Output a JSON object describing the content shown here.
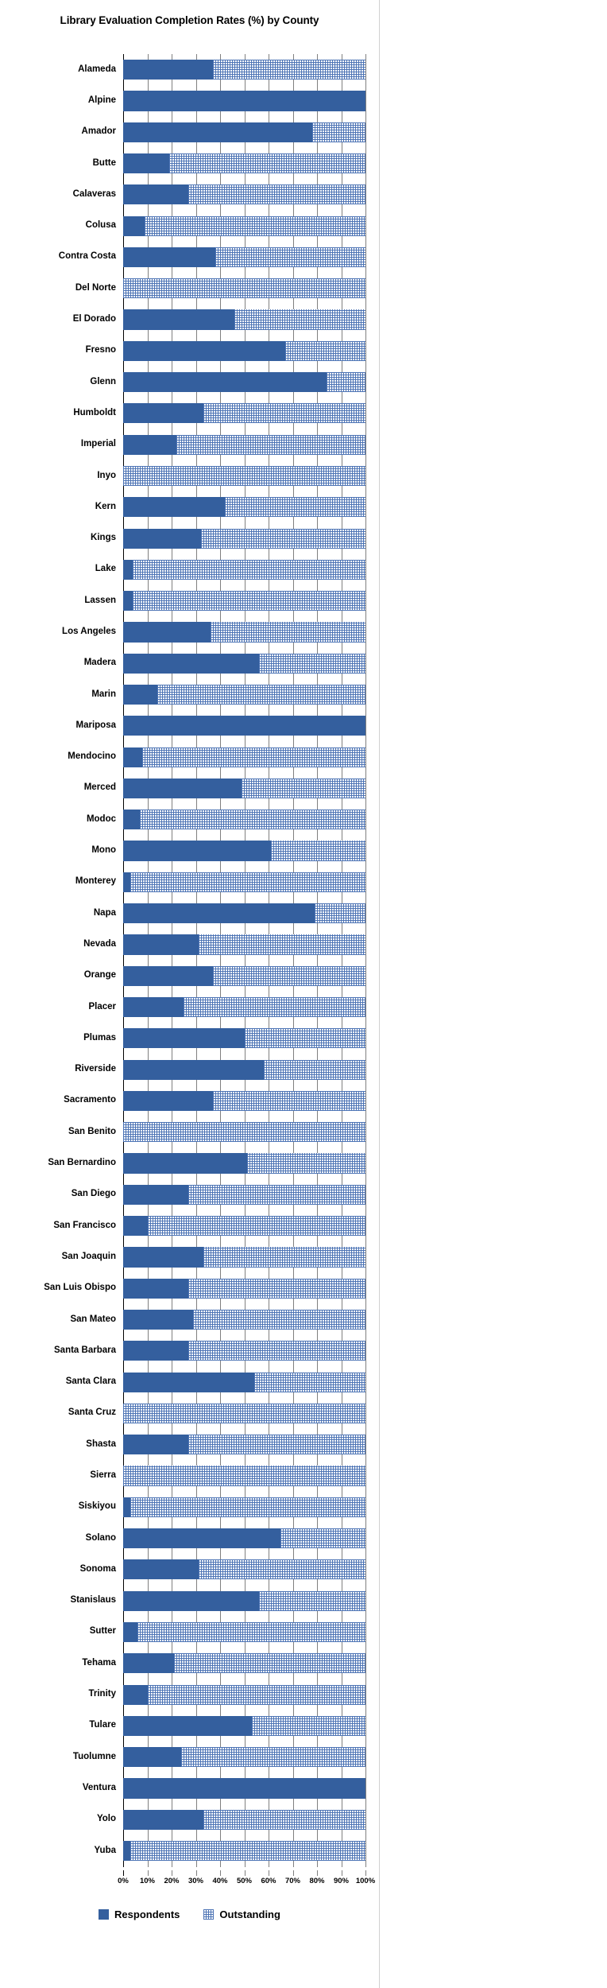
{
  "chart_data": {
    "type": "bar",
    "title": "Library Evaluation Completion Rates (%) by County",
    "xlabel": "",
    "ylabel": "",
    "orientation": "horizontal",
    "stacked": true,
    "xlim": [
      0,
      100
    ],
    "grid": true,
    "legend_position": "bottom",
    "colors": {
      "respondents": "#345F9E",
      "outstanding": "#4d74b5",
      "background": "#ffffff",
      "gridline": "#808080",
      "axis": "#000000"
    },
    "tick_labels": [
      "0%",
      "10%",
      "20%",
      "30%",
      "40%",
      "50%",
      "60%",
      "70%",
      "80%",
      "90%",
      "100%"
    ],
    "tick_values": [
      0,
      10,
      20,
      30,
      40,
      50,
      60,
      70,
      80,
      90,
      100
    ],
    "legend": [
      {
        "name": "Respondents",
        "style": "solid"
      },
      {
        "name": "Outstanding",
        "style": "hatched"
      }
    ],
    "categories": [
      "Alameda",
      "Alpine",
      "Amador",
      "Butte",
      "Calaveras",
      "Colusa",
      "Contra Costa",
      "Del Norte",
      "El Dorado",
      "Fresno",
      "Glenn",
      "Humboldt",
      "Imperial",
      "Inyo",
      "Kern",
      "Kings",
      "Lake",
      "Lassen",
      "Los Angeles",
      "Madera",
      "Marin",
      "Mariposa",
      "Mendocino",
      "Merced",
      "Modoc",
      "Mono",
      "Monterey",
      "Napa",
      "Nevada",
      "Orange",
      "Placer",
      "Plumas",
      "Riverside",
      "Sacramento",
      "San Benito",
      "San Bernardino",
      "San Diego",
      "San Francisco",
      "San Joaquin",
      "San Luis Obispo",
      "San Mateo",
      "Santa Barbara",
      "Santa Clara",
      "Santa Cruz",
      "Shasta",
      "Sierra",
      "Siskiyou",
      "Solano",
      "Sonoma",
      "Stanislaus",
      "Sutter",
      "Tehama",
      "Trinity",
      "Tulare",
      "Tuolumne",
      "Ventura",
      "Yolo",
      "Yuba"
    ],
    "series": [
      {
        "name": "Respondents",
        "values": [
          37,
          100,
          78,
          19,
          27,
          9,
          38,
          0,
          46,
          67,
          84,
          33,
          22,
          0,
          42,
          32,
          4,
          4,
          36,
          56,
          14,
          100,
          8,
          49,
          7,
          61,
          3,
          79,
          31,
          37,
          25,
          50,
          58,
          37,
          0,
          51,
          27,
          10,
          33,
          27,
          29,
          27,
          54,
          0,
          27,
          0,
          3,
          65,
          31,
          56,
          6,
          21,
          10,
          53,
          24,
          100,
          33,
          3
        ]
      },
      {
        "name": "Outstanding",
        "values": [
          63,
          0,
          22,
          81,
          73,
          91,
          62,
          100,
          54,
          33,
          16,
          67,
          78,
          100,
          58,
          68,
          96,
          96,
          64,
          44,
          86,
          0,
          92,
          51,
          93,
          39,
          97,
          21,
          69,
          63,
          75,
          50,
          42,
          63,
          100,
          49,
          73,
          90,
          67,
          73,
          71,
          73,
          46,
          100,
          73,
          100,
          97,
          35,
          69,
          44,
          94,
          79,
          90,
          47,
          76,
          0,
          67,
          97
        ]
      }
    ]
  }
}
